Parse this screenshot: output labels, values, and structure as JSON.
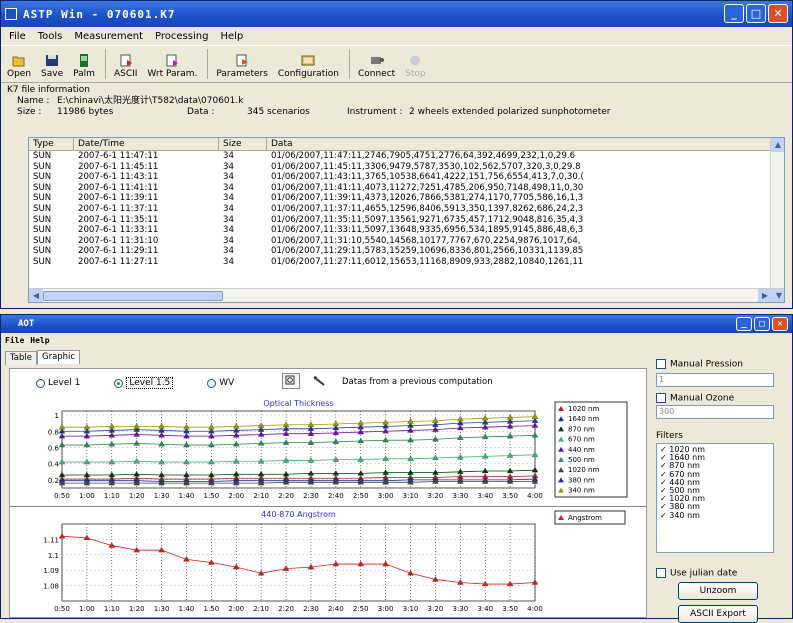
{
  "main_window": {
    "title": "ASTP Win - 070601.K7",
    "menu": [
      "File",
      "Tools",
      "Measurement",
      "Processing",
      "Help"
    ],
    "toolbar": [
      {
        "label": "Open",
        "icon": "folder-open-icon",
        "enabled": true
      },
      {
        "label": "Save",
        "icon": "floppy-disk-icon",
        "enabled": true
      },
      {
        "label": "Palm",
        "icon": "palm-device-icon",
        "enabled": true
      },
      {
        "label": "ASCII",
        "icon": "ascii-file-icon",
        "enabled": true
      },
      {
        "label": "Wrt Param.",
        "icon": "write-params-icon",
        "enabled": true
      },
      {
        "label": "Parameters",
        "icon": "parameters-icon",
        "enabled": true
      },
      {
        "label": "Configuration",
        "icon": "configuration-icon",
        "enabled": true
      },
      {
        "label": "Connect",
        "icon": "connect-icon",
        "enabled": true
      },
      {
        "label": "Stop",
        "icon": "stop-icon",
        "enabled": false
      }
    ],
    "info": {
      "heading": "K7 file information",
      "name_label": "Name :",
      "name_value": "E:\\chinavi\\太阳光度计\\T582\\data\\070601.k",
      "size_label": "Size :",
      "size_value": "11986 bytes",
      "data_label": "Data :",
      "data_value": "345 scenarios",
      "instrument_label": "Instrument :",
      "instrument_value": "2 wheels extended polarized sunphotometer"
    },
    "table": {
      "columns": [
        "Type",
        "Date/Time",
        "Size",
        "Data"
      ],
      "rows": [
        [
          "SUN",
          "2007-6-1 11:47:11",
          "34",
          "01/06/2007,11:47:11,2746,7905,4751,2776,64,392,4699,232,1,0,29.6"
        ],
        [
          "SUN",
          "2007-6-1 11:45:11",
          "34",
          "01/06/2007,11:45:11,3306,9479,5787,3530,102,562,5707,320,3,0,29.8"
        ],
        [
          "SUN",
          "2007-6-1 11:43:11",
          "34",
          "01/06/2007,11:43:11,3765,10538,6641,4222,151,756,6554,413,7,0,30.("
        ],
        [
          "SUN",
          "2007-6-1 11:41:11",
          "34",
          "01/06/2007,11:41:11,4073,11272,7251,4785,206,950,7148,498,11,0,30"
        ],
        [
          "SUN",
          "2007-6-1 11:39:11",
          "34",
          "01/06/2007,11:39:11,4373,12026,7866,5381,274,1170,7705,586,16,1,3"
        ],
        [
          "SUN",
          "2007-6-1 11:37:11",
          "34",
          "01/06/2007,11:37:11,4655,12596,8406,5913,350,1397,8262,686,24,2,3"
        ],
        [
          "SUN",
          "2007-6-1 11:35:11",
          "34",
          "01/06/2007,11:35:11,5097,13561,9271,6735,457,1712,9048,816,35,4,3"
        ],
        [
          "SUN",
          "2007-6-1 11:33:11",
          "34",
          "01/06/2007,11:33:11,5097,13648,9335,6956,534,1895,9145,886,48,6,3"
        ],
        [
          "SUN",
          "2007-6-1 11:31:10",
          "34",
          "01/06/2007,11:31:10,5540,14568,10177,7767,670,2254,9876,1017,64,"
        ],
        [
          "SUN",
          "2007-6-1 11:29:11",
          "34",
          "01/06/2007,11:29:11,5783,15259,10696,8336,801,2566,10331,1139,85"
        ],
        [
          "SUN",
          "2007-6-1 11:27:11",
          "34",
          "01/06/2007,11:27:11,6012,15653,11168,8909,933,2882,10840,1261,11"
        ]
      ]
    }
  },
  "aot_window": {
    "title": "AOT",
    "menu": [
      "File",
      "Help"
    ],
    "tabs": [
      "Table",
      "Graphic"
    ],
    "active_tab": "Graphic",
    "radios": [
      {
        "label": "Level 1",
        "selected": false
      },
      {
        "label": "Level 1.5",
        "selected": true
      },
      {
        "label": "WV",
        "selected": false
      }
    ],
    "datas_note": "Datas from a previous computation",
    "side": {
      "manual_pression": "Manual Pression",
      "pression_value": "1",
      "manual_ozone": "Manual Ozone",
      "ozone_value": "300",
      "filters_label": "Filters",
      "filters": [
        "1020 nm",
        "1640 nm",
        "870 nm",
        "670 nm",
        "440 nm",
        "500 nm",
        "1020 nm",
        "380 nm",
        "340 nm"
      ],
      "use_julian_date": "Use julian date",
      "unzoom": "Unzoom",
      "ascii_export": "ASCII Export"
    }
  },
  "chart_data": [
    {
      "type": "line",
      "title": "Optical Thickness",
      "x": [
        "0:50",
        "1:00",
        "1:10",
        "1:20",
        "1:30",
        "1:40",
        "1:50",
        "2:00",
        "2:10",
        "2:20",
        "2:30",
        "2:40",
        "2:50",
        "3:00",
        "3:10",
        "3:20",
        "3:30",
        "3:40",
        "3:50",
        "4:00"
      ],
      "ylim": [
        0.1,
        1.05
      ],
      "yticks": [
        "1",
        "0.8",
        "0.6",
        "0.4",
        "0.2"
      ],
      "legend_position": "right",
      "series": [
        {
          "name": "1020 nm",
          "color": "#b22222",
          "marker": "triangle",
          "values": [
            0.21,
            0.21,
            0.21,
            0.22,
            0.21,
            0.21,
            0.21,
            0.22,
            0.22,
            0.22,
            0.22,
            0.22,
            0.22,
            0.23,
            0.23,
            0.23,
            0.24,
            0.24,
            0.24,
            0.25
          ]
        },
        {
          "name": "1640 nm",
          "color": "#1a2ea0",
          "marker": "triangle",
          "values": [
            0.19,
            0.19,
            0.19,
            0.19,
            0.18,
            0.18,
            0.18,
            0.19,
            0.19,
            0.19,
            0.19,
            0.19,
            0.19,
            0.19,
            0.2,
            0.2,
            0.2,
            0.2,
            0.2,
            0.21
          ]
        },
        {
          "name": "870 nm",
          "color": "#003d00",
          "marker": "triangle",
          "values": [
            0.26,
            0.26,
            0.26,
            0.27,
            0.26,
            0.26,
            0.26,
            0.27,
            0.27,
            0.27,
            0.28,
            0.28,
            0.28,
            0.29,
            0.29,
            0.29,
            0.3,
            0.31,
            0.31,
            0.32
          ]
        },
        {
          "name": "670 nm",
          "color": "#3cb371",
          "marker": "triangle",
          "values": [
            0.42,
            0.42,
            0.42,
            0.43,
            0.42,
            0.42,
            0.42,
            0.43,
            0.43,
            0.44,
            0.44,
            0.45,
            0.45,
            0.46,
            0.46,
            0.47,
            0.48,
            0.49,
            0.5,
            0.51
          ]
        },
        {
          "name": "440 nm",
          "color": "#6a0dad",
          "marker": "triangle",
          "values": [
            0.74,
            0.74,
            0.75,
            0.76,
            0.75,
            0.74,
            0.74,
            0.75,
            0.76,
            0.77,
            0.77,
            0.78,
            0.79,
            0.8,
            0.81,
            0.82,
            0.84,
            0.85,
            0.86,
            0.87
          ]
        },
        {
          "name": "500 nm",
          "color": "#2e8b57",
          "marker": "triangle",
          "values": [
            0.63,
            0.63,
            0.64,
            0.65,
            0.64,
            0.63,
            0.63,
            0.64,
            0.65,
            0.66,
            0.66,
            0.67,
            0.68,
            0.69,
            0.69,
            0.7,
            0.72,
            0.73,
            0.74,
            0.75
          ]
        },
        {
          "name": "1020 nm",
          "color": "#444444",
          "marker": "triangle",
          "values": [
            0.16,
            0.16,
            0.16,
            0.16,
            0.16,
            0.16,
            0.16,
            0.16,
            0.16,
            0.17,
            0.17,
            0.17,
            0.17,
            0.17,
            0.17,
            0.18,
            0.18,
            0.18,
            0.18,
            0.18
          ]
        },
        {
          "name": "380 nm",
          "color": "#1e3a8a",
          "marker": "triangle",
          "values": [
            0.8,
            0.8,
            0.81,
            0.82,
            0.81,
            0.8,
            0.8,
            0.81,
            0.82,
            0.83,
            0.83,
            0.84,
            0.85,
            0.86,
            0.87,
            0.88,
            0.9,
            0.91,
            0.92,
            0.93
          ]
        },
        {
          "name": "340 nm",
          "color": "#9a9a00",
          "marker": "triangle",
          "values": [
            0.85,
            0.85,
            0.86,
            0.86,
            0.86,
            0.85,
            0.85,
            0.86,
            0.87,
            0.88,
            0.88,
            0.89,
            0.9,
            0.91,
            0.92,
            0.93,
            0.95,
            0.96,
            0.97,
            0.98
          ]
        }
      ]
    },
    {
      "type": "line",
      "title": "440-870 Angstrom",
      "x": [
        "0:50",
        "1:00",
        "1:10",
        "1:20",
        "1:30",
        "1:40",
        "1:50",
        "2:00",
        "2:10",
        "2:20",
        "2:30",
        "2:40",
        "2:50",
        "3:00",
        "3:10",
        "3:20",
        "3:30",
        "3:40",
        "3:50",
        "4:00"
      ],
      "ylim": [
        1.07,
        1.12
      ],
      "yticks": [
        "1.11",
        "1.1",
        "1.09",
        "1.08"
      ],
      "legend_position": "top-right",
      "series": [
        {
          "name": "Angstrom",
          "color": "#cc2222",
          "marker": "triangle",
          "values": [
            1.112,
            1.111,
            1.106,
            1.103,
            1.103,
            1.097,
            1.095,
            1.092,
            1.088,
            1.091,
            1.092,
            1.094,
            1.094,
            1.094,
            1.088,
            1.084,
            1.082,
            1.081,
            1.081,
            1.082
          ]
        }
      ]
    }
  ]
}
